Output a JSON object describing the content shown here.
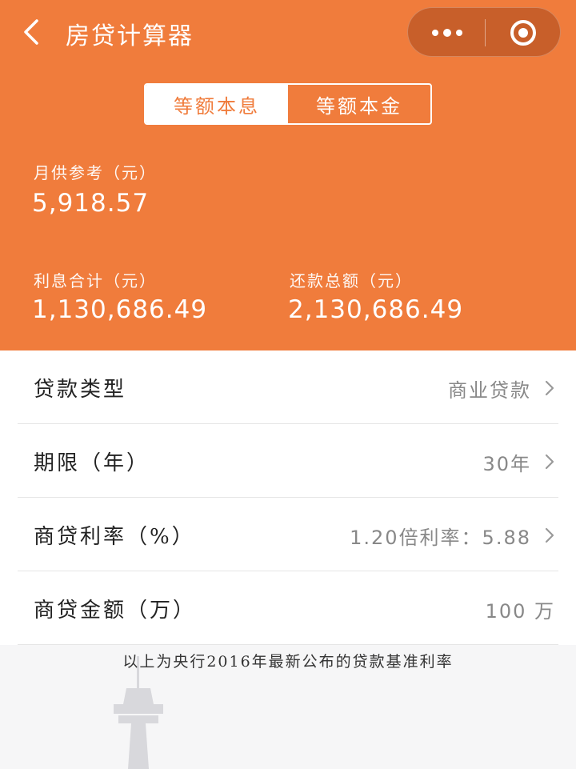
{
  "header": {
    "title": "房贷计算器",
    "accent_color": "#f07c3c",
    "icons": {
      "back": "chevron-left-icon",
      "more": "more-dots-icon",
      "close": "target-icon"
    }
  },
  "tabs": [
    {
      "label": "等额本息",
      "active": true
    },
    {
      "label": "等额本金",
      "active": false
    }
  ],
  "summary": {
    "monthly_label": "月供参考（元）",
    "monthly_value": "5,918.57",
    "interest_label": "利息合计（元）",
    "interest_value": "1,130,686.49",
    "total_label": "还款总额（元）",
    "total_value": "2,130,686.49"
  },
  "settings": [
    {
      "label": "贷款类型",
      "value": "商业贷款"
    },
    {
      "label": "期限（年）",
      "value": "30年"
    },
    {
      "label": "商贷利率（%）",
      "value": "1.20倍利率：5.88"
    },
    {
      "label": "商贷金额（万）",
      "value": "100 万"
    }
  ],
  "footnote": "以上为央行2016年最新公布的贷款基准利率"
}
